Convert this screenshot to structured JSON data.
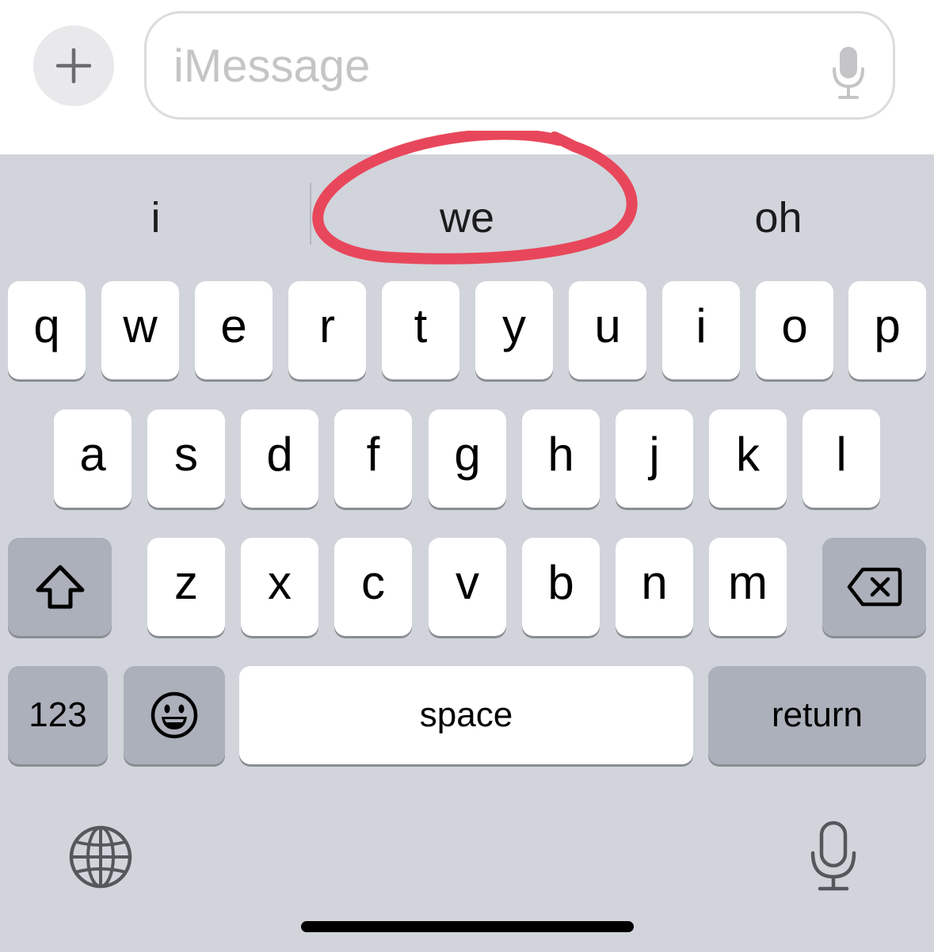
{
  "compose": {
    "plus_icon": "plus-icon",
    "placeholder": "iMessage",
    "mic_icon": "microphone-icon"
  },
  "suggestions": [
    "i",
    "we",
    "oh"
  ],
  "highlighted_suggestion": "we",
  "highlight_color": "#e8475b",
  "rows": {
    "row1": [
      "q",
      "w",
      "e",
      "r",
      "t",
      "y",
      "u",
      "i",
      "o",
      "p"
    ],
    "row2": [
      "a",
      "s",
      "d",
      "f",
      "g",
      "h",
      "j",
      "k",
      "l"
    ],
    "row3": [
      "z",
      "x",
      "c",
      "v",
      "b",
      "n",
      "m"
    ]
  },
  "keys": {
    "shift_icon": "shift-icon",
    "delete_icon": "delete-icon",
    "numbers_label": "123",
    "emoji_icon": "emoji-icon",
    "space_label": "space",
    "return_label": "return",
    "globe_icon": "globe-icon",
    "dictation_icon": "microphone-icon"
  },
  "colors": {
    "keyboard_bg": "#d1d4db",
    "key_light": "#ffffff",
    "key_dark": "#abb0ba"
  }
}
